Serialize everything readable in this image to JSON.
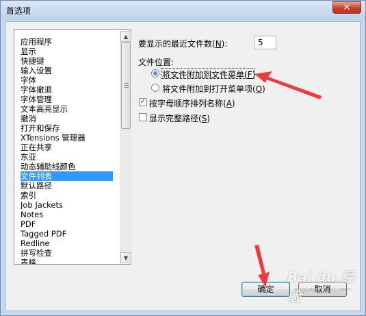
{
  "window": {
    "title": "首选项",
    "close_glyph": "✕"
  },
  "sidebar": {
    "items": [
      {
        "label": "应用程序",
        "selected": false
      },
      {
        "label": "显示",
        "selected": false
      },
      {
        "label": "快捷键",
        "selected": false
      },
      {
        "label": "输入设置",
        "selected": false
      },
      {
        "label": "字体",
        "selected": false
      },
      {
        "label": "字体撤退",
        "selected": false
      },
      {
        "label": "字体管理",
        "selected": false
      },
      {
        "label": "文本高亮显示",
        "selected": false
      },
      {
        "label": "撤消",
        "selected": false
      },
      {
        "label": "打开和保存",
        "selected": false
      },
      {
        "label": "XTensions 管理器",
        "selected": false
      },
      {
        "label": "正在共享",
        "selected": false
      },
      {
        "label": "东亚",
        "selected": false
      },
      {
        "label": "动态辅助线颜色",
        "selected": false
      },
      {
        "label": "文件列表",
        "selected": true
      },
      {
        "label": "默认路径",
        "selected": false
      },
      {
        "label": "索引",
        "selected": false
      },
      {
        "label": "Job Jackets",
        "selected": false
      },
      {
        "label": "Notes",
        "selected": false
      },
      {
        "label": "PDF",
        "selected": false
      },
      {
        "label": "Tagged PDF",
        "selected": false
      },
      {
        "label": "Redline",
        "selected": false
      },
      {
        "label": "拼写检查",
        "selected": false
      },
      {
        "label": "表格",
        "selected": false
      }
    ]
  },
  "settings": {
    "recent_count_label_pre": "要显示的最近文件数(",
    "recent_count_label_key": "N",
    "recent_count_label_post": "):",
    "recent_count_value": "5",
    "location_group_label": "文件位置:",
    "radio_file_menu_pre": "将文件附加到文件菜单(",
    "radio_file_menu_key": "F",
    "radio_file_menu_post": ")",
    "radio_file_menu_checked": true,
    "radio_open_menu_pre": "将文件附加到打开菜单项(",
    "radio_open_menu_key": "O",
    "radio_open_menu_post": ")",
    "radio_open_menu_checked": false,
    "check_alpha_pre": "按字母顺序排列名称(",
    "check_alpha_key": "A",
    "check_alpha_post": ")",
    "check_alpha_checked": true,
    "check_fullpath_pre": "显示完整路径(",
    "check_fullpath_key": "S",
    "check_fullpath_post": ")",
    "check_fullpath_checked": false,
    "check_mark": "✓"
  },
  "footer": {
    "ok_label": "确定",
    "cancel_label": "取消"
  },
  "watermark": {
    "text": "Bai du 经验",
    "subtext": "jingyan.baidu.com"
  },
  "annotations": {
    "arrow_color": "#f0393a"
  }
}
